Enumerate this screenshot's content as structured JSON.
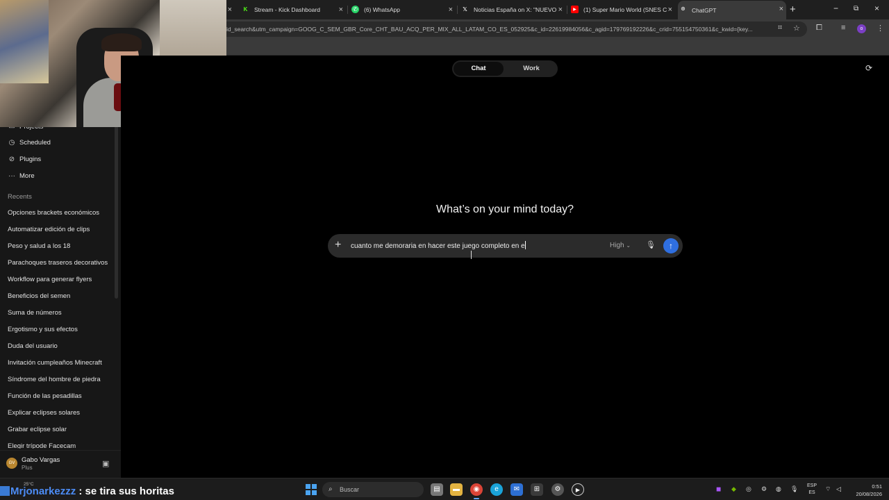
{
  "browser": {
    "tabs": [
      {
        "title": "Stream - Kick Dashboard",
        "icon": "kick-icon"
      },
      {
        "title": "(6) WhatsApp",
        "icon": "whatsapp-icon"
      },
      {
        "title": "Noticias España on X: \"NUEVO",
        "icon": "x-icon"
      },
      {
        "title": "(1) Super Mario World (SNES C",
        "icon": "youtube-icon"
      },
      {
        "title": "ChatGPT",
        "icon": "chatgpt-icon"
      }
    ],
    "url": "id_search&utm_campaign=GOOG_C_SEM_GBR_Core_CHT_BAU_ACQ_PER_MIX_ALL_LATAM_CO_ES_052925&c_id=22619984056&c_agid=179769192226&c_crid=755154750361&c_kwid={key...",
    "profile_initial": "o"
  },
  "sidebar": {
    "nav": [
      {
        "label": "Projects",
        "icon": "folder-icon"
      },
      {
        "label": "Scheduled",
        "icon": "clock-icon"
      },
      {
        "label": "Plugins",
        "icon": "plugin-icon"
      },
      {
        "label": "More",
        "icon": "more-icon"
      }
    ],
    "recents_heading": "Recents",
    "recents": [
      "Opciones brackets económicos",
      "Automatizar edición de clips",
      "Peso y salud a los 18",
      "Parachoques traseros decorativos",
      "Workflow para generar flyers",
      "Beneficios del semen",
      "Suma de números",
      "Ergotismo y sus efectos",
      "Duda del usuario",
      "Invitación cumpleaños Minecraft",
      "Síndrome del hombre de piedra",
      "Función de las pesadillas",
      "Explicar eclipses solares",
      "Grabar eclipse solar",
      "Elegir trípode Facecam"
    ],
    "user": {
      "name": "Gabo Vargas",
      "plan": "Plus",
      "initials": "GV"
    }
  },
  "main": {
    "mode_tabs": [
      "Chat",
      "Work"
    ],
    "active_mode": "Chat",
    "heading": "What’s on your mind today?",
    "composer": {
      "text": "cuanto me demoraria en hacer este juego completo en e",
      "effort": "High"
    }
  },
  "stream_overlay": {
    "username": "Mrjonarkezzz",
    "separator": ":",
    "message": "se tira sus horitas"
  },
  "taskbar": {
    "weather": "25°C",
    "search_placeholder": "Buscar",
    "language": [
      "ESP",
      "ES"
    ],
    "time": "0:51",
    "date": "20/08/2026"
  },
  "colors": {
    "accent": "#2f6fe0",
    "chat_username": "#4c8cf5"
  }
}
